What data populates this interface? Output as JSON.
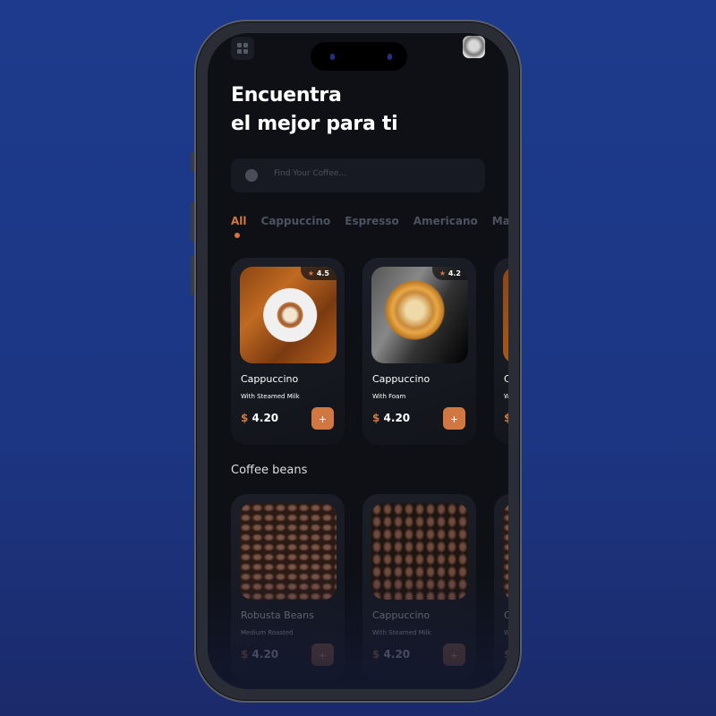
{
  "header": {
    "title_line1": "Encuentra",
    "title_line2": "el mejor para ti"
  },
  "search": {
    "placeholder": "Find Your Coffee..."
  },
  "tabs": [
    {
      "label": "All",
      "active": true
    },
    {
      "label": "Cappuccino"
    },
    {
      "label": "Espresso"
    },
    {
      "label": "Americano"
    },
    {
      "label": "Macc"
    }
  ],
  "coffees": [
    {
      "rating": "4.5",
      "name": "Cappuccino",
      "sub": "With Steamed Milk",
      "currency": "$",
      "price": "4.20",
      "add": "+"
    },
    {
      "rating": "4.2",
      "name": "Cappuccino",
      "sub": "With Foam",
      "currency": "$",
      "price": "4.20",
      "add": "+"
    },
    {
      "name": "C",
      "sub": "W",
      "currency": "$"
    }
  ],
  "beans_section": {
    "title": "Coffee beans"
  },
  "beans": [
    {
      "name": "Robusta Beans",
      "sub": "Medium Roasted",
      "currency": "$",
      "price": "4.20",
      "add": "+"
    },
    {
      "name": "Cappuccino",
      "sub": "With Steamed Milk",
      "currency": "$",
      "price": "4.20",
      "add": "+"
    },
    {
      "name": "C",
      "sub": "W",
      "currency": "$"
    }
  ],
  "colors": {
    "accent": "#d17842",
    "background": "#1d3a8c",
    "screen": "#0e1015"
  }
}
